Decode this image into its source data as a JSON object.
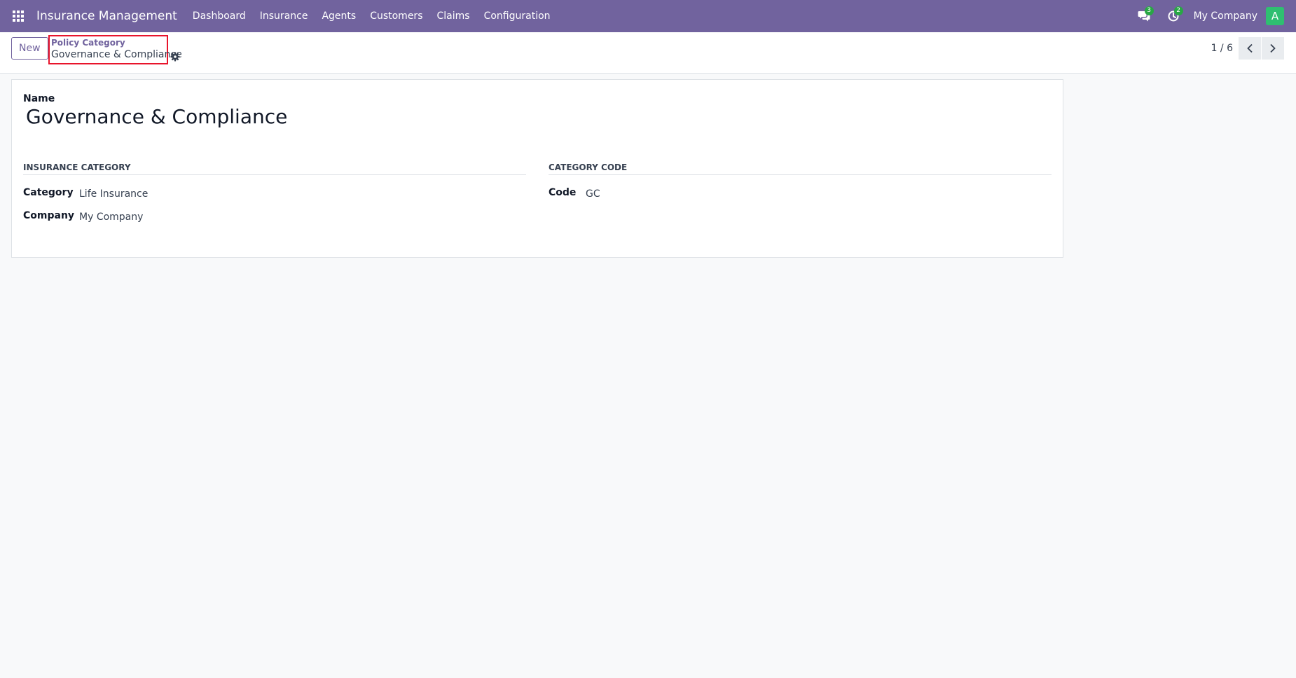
{
  "navbar": {
    "app_name": "Insurance Management",
    "menu": [
      {
        "label": "Dashboard"
      },
      {
        "label": "Insurance"
      },
      {
        "label": "Agents"
      },
      {
        "label": "Customers"
      },
      {
        "label": "Claims"
      },
      {
        "label": "Configuration"
      }
    ],
    "messages_badge": "3",
    "activities_badge": "2",
    "company": "My Company",
    "avatar_initial": "A",
    "colors": {
      "navbar": "#71639e",
      "badge": "#28a745",
      "avatar": "#2fbf71"
    }
  },
  "control_panel": {
    "new_label": "New",
    "breadcrumb_parent": "Policy Category",
    "breadcrumb_current": "Governance & Compliance",
    "pager_value": "1 / 6",
    "icons": [
      "gear-icon",
      "chevron-left-icon",
      "chevron-right-icon"
    ]
  },
  "form": {
    "name_label": "Name",
    "name_value": "Governance & Compliance",
    "groups": [
      {
        "title": "Insurance Category",
        "fields": [
          {
            "label": "Category",
            "value": "Life Insurance"
          },
          {
            "label": "Company",
            "value": "My Company"
          }
        ]
      },
      {
        "title": "Category Code",
        "fields": [
          {
            "label": "Code",
            "value": "GC"
          }
        ]
      }
    ]
  }
}
